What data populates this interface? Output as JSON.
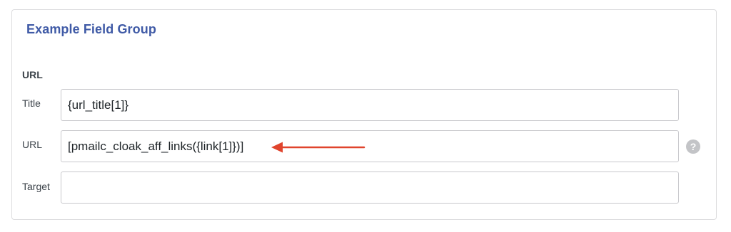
{
  "field_group": {
    "title": "Example Field Group",
    "section_label": "URL",
    "fields": [
      {
        "label": "Title",
        "value": "{url_title[1]}"
      },
      {
        "label": "URL",
        "value": "[pmailc_cloak_aff_links({link[1]})]"
      },
      {
        "label": "Target",
        "value": ""
      }
    ],
    "help_icon": {
      "glyph": "?",
      "icon": "help-circle-icon"
    }
  },
  "annotation": {
    "icon": "arrow-left-icon",
    "color": "#e0442d"
  }
}
